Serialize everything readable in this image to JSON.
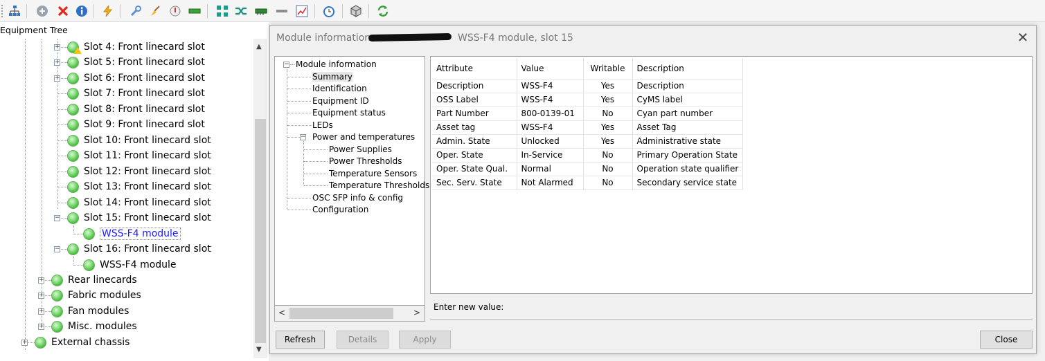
{
  "toolbar": {
    "icons": [
      "network-tree-icon",
      "add-circle-icon",
      "delete-x-icon",
      "info-icon",
      "lightning-icon",
      "wrench-icon",
      "broom-icon",
      "thermometer-icon",
      "module-card-icon",
      "expand-icon",
      "shuffle-icon",
      "board-icon",
      "bar-icon",
      "chart-icon",
      "alarm-clock-icon",
      "box-3d-icon",
      "refresh-icon"
    ]
  },
  "tree": {
    "title": "Equipment Tree",
    "nodes": [
      {
        "label": "Slot 4: Front linecard slot"
      },
      {
        "label": "Slot 5: Front linecard slot"
      },
      {
        "label": "Slot 6: Front linecard slot"
      },
      {
        "label": "Slot 7: Front linecard slot"
      },
      {
        "label": "Slot 8: Front linecard slot"
      },
      {
        "label": "Slot 9: Front linecard slot"
      },
      {
        "label": "Slot 10: Front linecard slot"
      },
      {
        "label": "Slot 11: Front linecard slot"
      },
      {
        "label": "Slot 12: Front linecard slot"
      },
      {
        "label": "Slot 13: Front linecard slot"
      },
      {
        "label": "Slot 14: Front linecard slot"
      },
      {
        "label": "Slot 15: Front linecard slot"
      },
      {
        "label": "WSS-F4 module"
      },
      {
        "label": "Slot 16: Front linecard slot"
      },
      {
        "label": "WSS-F4 module"
      },
      {
        "label": "Rear linecards"
      },
      {
        "label": "Fabric modules"
      },
      {
        "label": "Fan modules"
      },
      {
        "label": "Misc. modules"
      },
      {
        "label": "External chassis"
      }
    ]
  },
  "modal": {
    "title_prefix": "Module information -",
    "title_suffix": "WSS-F4 module, slot 15",
    "close_glyph": "✕",
    "tree_items": [
      "Module information",
      "Summary",
      "Identification",
      "Equipment ID",
      "Equipment status",
      "LEDs",
      "Power and temperatures",
      "Power Supplies",
      "Power Thresholds",
      "Temperature Sensors",
      "Temperature Thresholds",
      "OSC SFP info & config",
      "Configuration"
    ],
    "columns": [
      "Attribute",
      "Value",
      "Writable",
      "Description"
    ],
    "rows": [
      [
        "Description",
        "WSS-F4",
        "Yes",
        "Description"
      ],
      [
        "OSS Label",
        "WSS-F4",
        "Yes",
        "CyMS label"
      ],
      [
        "Part Number",
        "800-0139-01",
        "No",
        "Cyan part number"
      ],
      [
        "Asset tag",
        "WSS-F4",
        "Yes",
        "Asset Tag"
      ],
      [
        "Admin. State",
        "Unlocked",
        "Yes",
        "Administrative state"
      ],
      [
        "Oper. State",
        "In-Service",
        "No",
        "Primary Operation State"
      ],
      [
        "Oper. State Qual.",
        "Normal",
        "No",
        "Operation state qualifier"
      ],
      [
        "Sec. Serv. State",
        "Not Alarmed",
        "No",
        "Secondary service state"
      ]
    ],
    "new_value_label": "Enter new value:",
    "buttons": {
      "refresh": "Refresh",
      "details": "Details",
      "apply": "Apply",
      "close": "Close"
    }
  }
}
